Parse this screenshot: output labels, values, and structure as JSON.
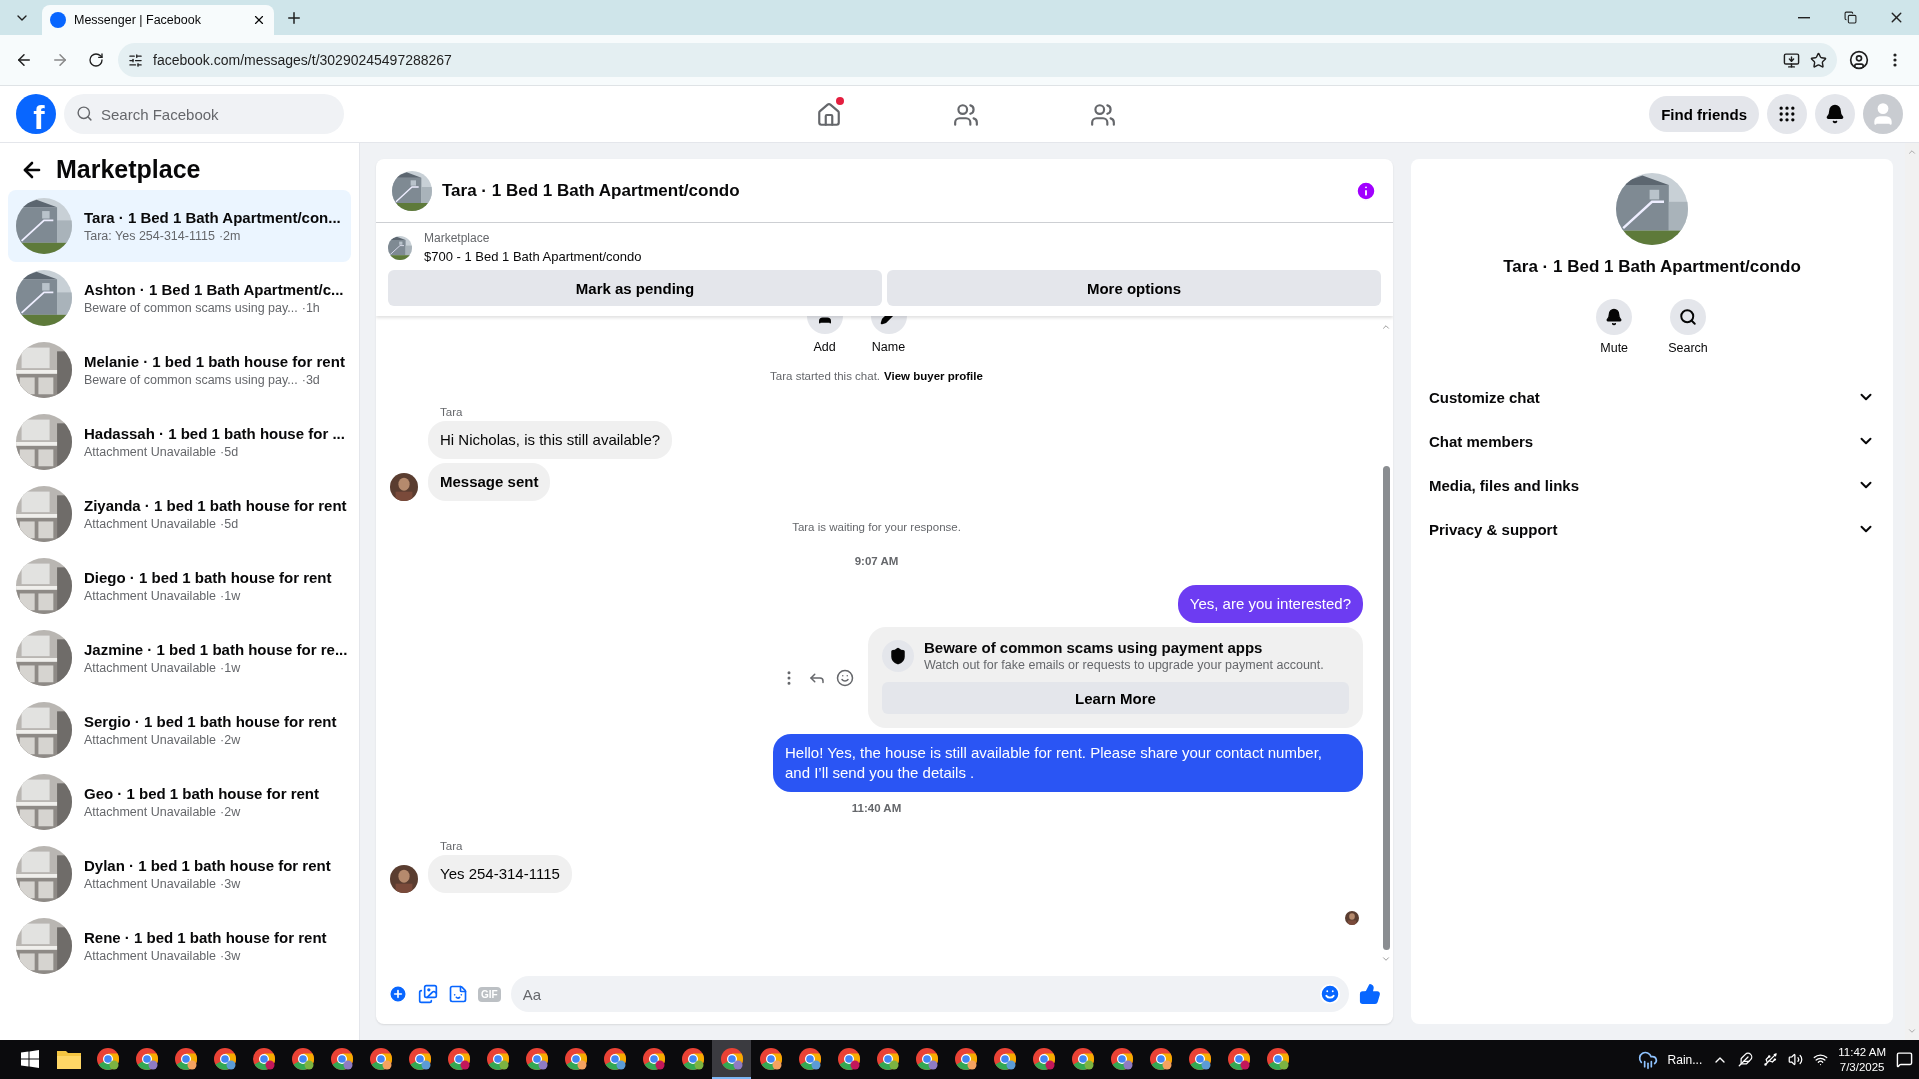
{
  "browser": {
    "tab_title": "Messenger | Facebook",
    "url": "facebook.com/messages/t/30290245497288267"
  },
  "topnav": {
    "logo": "f",
    "search_placeholder": "Search Facebook",
    "nav": [
      {
        "kind": "home",
        "dot": true
      },
      {
        "kind": "friends",
        "dot": false
      },
      {
        "kind": "groups",
        "dot": false
      }
    ],
    "find_friends": "Find friends"
  },
  "sidebar": {
    "title": "Marketplace",
    "conversations": [
      {
        "name": "Tara · 1 Bed 1 Bath Apartment/con...",
        "preview": "Tara: Yes 254-314-1115",
        "time": "·2m",
        "kind": "house",
        "selected": true
      },
      {
        "name": "Ashton · 1 Bed 1 Bath Apartment/c...",
        "preview": "Beware of common scams using pay...",
        "time": "·1h",
        "kind": "house",
        "selected": false
      },
      {
        "name": "Melanie · 1 bed 1 bath house for rent",
        "preview": "Beware of common scams using pay...",
        "time": "·3d",
        "kind": "room",
        "selected": false
      },
      {
        "name": "Hadassah · 1 bed 1 bath house for ...",
        "preview": "Attachment Unavailable",
        "time": "·5d",
        "kind": "room",
        "selected": false
      },
      {
        "name": "Ziyanda · 1 bed 1 bath house for rent",
        "preview": "Attachment Unavailable",
        "time": "·5d",
        "kind": "room",
        "selected": false
      },
      {
        "name": "Diego · 1 bed 1 bath house for rent",
        "preview": "Attachment Unavailable",
        "time": "·1w",
        "kind": "room",
        "selected": false
      },
      {
        "name": "Jazmine · 1 bed 1 bath house for re...",
        "preview": "Attachment Unavailable",
        "time": "·1w",
        "kind": "room",
        "selected": false
      },
      {
        "name": "Sergio · 1 bed 1 bath house for rent",
        "preview": "Attachment Unavailable",
        "time": "·2w",
        "kind": "room",
        "selected": false
      },
      {
        "name": "Geo · 1 bed 1 bath house for rent",
        "preview": "Attachment Unavailable",
        "time": "·2w",
        "kind": "room",
        "selected": false
      },
      {
        "name": "Dylan · 1 bed 1 bath house for rent",
        "preview": "Attachment Unavailable",
        "time": "·3w",
        "kind": "room",
        "selected": false
      },
      {
        "name": "Rene · 1 bed 1 bath house for rent",
        "preview": "Attachment Unavailable",
        "time": "·3w",
        "kind": "room",
        "selected": false
      }
    ]
  },
  "chat": {
    "title": "Tara · 1 Bed 1 Bath Apartment/condo",
    "listing_label": "Marketplace",
    "listing": "$700 - 1 Bed 1 Bath Apartment/condo",
    "actions": [
      "Mark as pending",
      "More options"
    ],
    "top_actions": [
      {
        "kind": "add",
        "label": "Add"
      },
      {
        "kind": "name",
        "label": "Name"
      }
    ],
    "messages": [
      {
        "kind": "system",
        "text": "Tara started this chat.",
        "link": "View buyer profile"
      },
      {
        "kind": "sender",
        "text": "Tara"
      },
      {
        "kind": "incoming",
        "text": "Hi Nicholas, is this still available?",
        "avatar": false,
        "bold": false
      },
      {
        "kind": "incoming",
        "text": "Message sent",
        "avatar": true,
        "bold": true
      },
      {
        "kind": "system",
        "text": "Tara is waiting for your response."
      },
      {
        "kind": "time",
        "text": "9:07 AM"
      },
      {
        "kind": "outgoing",
        "text": "Yes, are you interested?",
        "color": "#6d3cf2"
      },
      {
        "kind": "notice",
        "title": "Beware of common scams using payment apps",
        "text": "Watch out for fake emails or requests to upgrade your payment account.",
        "button": "Learn More"
      },
      {
        "kind": "outgoing",
        "text": "Hello! Yes, the house is still available for rent. Please share your contact number, and I’ll send you the details .",
        "color": "#2a55f4"
      },
      {
        "kind": "time",
        "text": "11:40 AM"
      },
      {
        "kind": "sender",
        "text": "Tara"
      },
      {
        "kind": "incoming",
        "text": "Yes 254-314-1115",
        "avatar": true,
        "bold": false
      }
    ],
    "composer": {
      "placeholder": "Aa",
      "gif": "GIF"
    }
  },
  "details": {
    "name": "Tara · 1 Bed 1 Bath Apartment/condo",
    "actions": [
      {
        "kind": "mute",
        "label": "Mute"
      },
      {
        "kind": "search",
        "label": "Search"
      }
    ],
    "sections": [
      {
        "label": "Customize chat",
        "expanded": false
      },
      {
        "label": "Chat members",
        "expanded": false
      },
      {
        "label": "Media, files and links",
        "expanded": false
      },
      {
        "label": "Privacy & support",
        "expanded": false
      }
    ]
  },
  "taskbar": {
    "apps": [
      {
        "kind": "explorer",
        "active": false
      },
      {
        "kind": "chrome",
        "active": false
      },
      {
        "kind": "chrome",
        "active": false
      },
      {
        "kind": "chrome",
        "active": false
      },
      {
        "kind": "chrome",
        "active": false
      },
      {
        "kind": "chrome",
        "active": false
      },
      {
        "kind": "chrome",
        "active": false
      },
      {
        "kind": "chrome",
        "active": false
      },
      {
        "kind": "chrome",
        "active": false
      },
      {
        "kind": "chrome",
        "active": false
      },
      {
        "kind": "chrome",
        "active": false
      },
      {
        "kind": "chrome",
        "active": false
      },
      {
        "kind": "chrome",
        "active": false
      },
      {
        "kind": "chrome",
        "active": false
      },
      {
        "kind": "chrome",
        "active": false
      },
      {
        "kind": "chrome",
        "active": false
      },
      {
        "kind": "chrome",
        "active": false
      },
      {
        "kind": "chrome",
        "active": true
      },
      {
        "kind": "chrome",
        "active": false
      },
      {
        "kind": "chrome",
        "active": false
      },
      {
        "kind": "chrome",
        "active": false
      },
      {
        "kind": "chrome",
        "active": false
      },
      {
        "kind": "chrome",
        "active": false
      },
      {
        "kind": "chrome",
        "active": false
      },
      {
        "kind": "chrome",
        "active": false
      },
      {
        "kind": "chrome",
        "active": false
      },
      {
        "kind": "chrome",
        "active": false
      },
      {
        "kind": "chrome",
        "active": false
      },
      {
        "kind": "chrome",
        "active": false
      },
      {
        "kind": "chrome",
        "active": false
      },
      {
        "kind": "chrome",
        "active": false
      },
      {
        "kind": "chrome",
        "active": false
      }
    ],
    "weather": "Rain...",
    "time": "11:42 AM",
    "date": "7/3/2025"
  }
}
